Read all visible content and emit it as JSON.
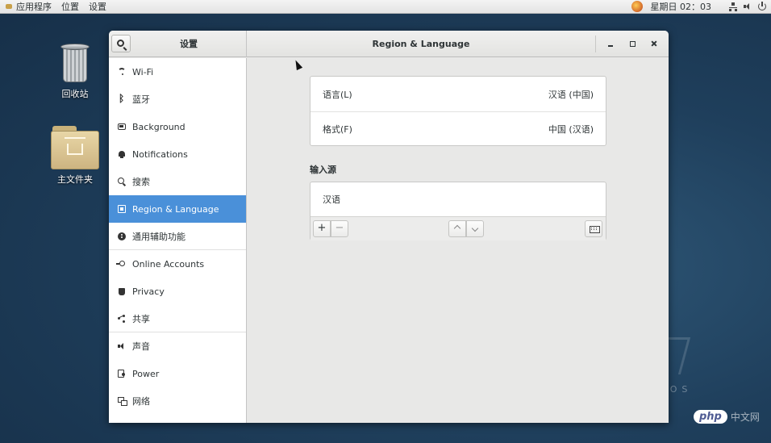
{
  "topbar": {
    "applications": "应用程序",
    "places": "位置",
    "settings": "设置",
    "clock": "星期日 02：03"
  },
  "desktop": {
    "trash_label": "回收站",
    "home_label": "主文件夹"
  },
  "window": {
    "sidebar_title": "设置",
    "title": "Region & Language"
  },
  "sidebar": {
    "items": [
      {
        "label": "Wi-Fi",
        "icon": "wifi-icon"
      },
      {
        "label": "蓝牙",
        "icon": "bluetooth-icon"
      },
      {
        "label": "Background",
        "icon": "background-icon"
      },
      {
        "label": "Notifications",
        "icon": "bell-icon"
      },
      {
        "label": "搜索",
        "icon": "search-icon"
      },
      {
        "label": "Region & Language",
        "icon": "flag-icon",
        "active": true
      },
      {
        "label": "通用辅助功能",
        "icon": "accessibility-icon"
      },
      {
        "label": "Online Accounts",
        "icon": "online-accounts-icon"
      },
      {
        "label": "Privacy",
        "icon": "hand-icon"
      },
      {
        "label": "共享",
        "icon": "share-icon"
      },
      {
        "label": "声音",
        "icon": "speaker-icon"
      },
      {
        "label": "Power",
        "icon": "power-icon"
      },
      {
        "label": "网络",
        "icon": "network-icon"
      }
    ]
  },
  "region": {
    "language_label": "语言(L)",
    "language_value": "汉语 (中国)",
    "formats_label": "格式(F)",
    "formats_value": "中国 (汉语)",
    "input_sources_heading": "输入源",
    "input_source": "汉语",
    "add_symbol": "+",
    "remove_symbol": "−"
  },
  "watermark": {
    "centos": "TOS",
    "php": "php",
    "site": "中文网"
  },
  "colors": {
    "accent": "#4a90d9",
    "desktop": "#1f3f5c"
  }
}
